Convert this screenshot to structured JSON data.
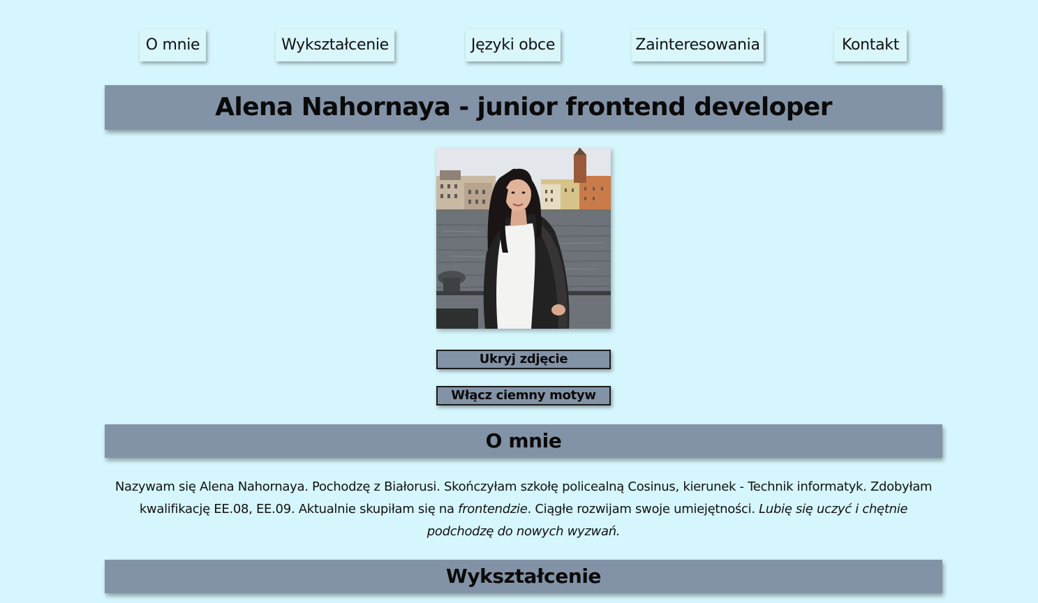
{
  "nav": {
    "items": [
      "O mnie",
      "Wykształcenie",
      "Języki obce",
      "Zainteresowania",
      "Kontakt"
    ]
  },
  "header": {
    "title": "Alena Nahornaya - junior frontend developer"
  },
  "photo": {
    "alt": "Zdjęcie Alena Nahornaya"
  },
  "buttons": {
    "hide_photo": "Ukryj zdjęcie",
    "dark_theme": "Włącz ciemny motyw"
  },
  "sections": {
    "about_title": "O mnie",
    "about_text_1": "Nazywam się Alena Nahornaya. Pochodzę z Białorusi. Skończyłam szkołę policealną Cosinus, kierunek - Technik informatyk. Zdobyłam kwalifikację EE.08, EE.09. Aktualnie skupiłam się na ",
    "about_em_1": "frontendzie",
    "about_text_2": ". Ciągłe rozwijam swoje umiejętności. ",
    "about_em_2": "Lubię się uczyć i chętnie podchodzę do nowych wyzwań.",
    "education_title": "Wykształcenie"
  },
  "colors": {
    "background": "#d5f6fc",
    "banner": "#8393a7",
    "nav_item": "#d9f6fb"
  }
}
